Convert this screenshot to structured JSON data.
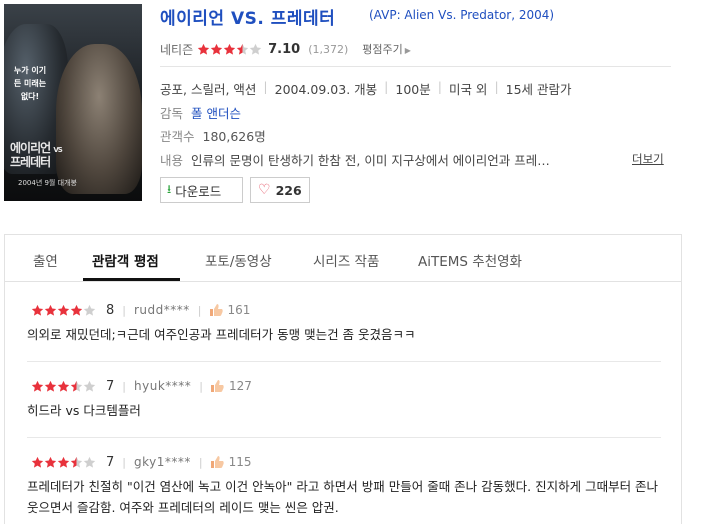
{
  "movie": {
    "title": "에이리언 VS. 프레데터",
    "subtitle": "(AVP: Alien Vs. Predator, 2004)",
    "rating_label": "네티즌",
    "rating_stars": 3.5,
    "rating_score": "7.10",
    "rating_votes": "(1,372)",
    "rate_button": "평점주기",
    "info": [
      "공포, 스릴러, 액션",
      "2004.09.03. 개봉",
      "100분",
      "미국 외",
      "15세 관람가"
    ],
    "director_label": "감독",
    "director": "폴 앤더슨",
    "viewers_label": "관객수",
    "viewers": "180,626명",
    "synopsis_label": "내용",
    "synopsis": "인류의 문명이 탄생하기 한참 전, 이미 지구상에서 에이리언과 프레…",
    "more_link": "더보기",
    "download_button": "다운로드",
    "like_count": "226"
  },
  "poster": {
    "tagline": "누가 이기든 미래는 없다!",
    "title_line1": "에이리언",
    "title_vs": "VS",
    "title_line2": "프레데터",
    "date": "2004년 9월 대개봉"
  },
  "tabs": [
    "출연",
    "관람객 평점",
    "포토/동영상",
    "시리즈 작품",
    "AiTEMS 추천영화"
  ],
  "active_tab": "관람객 평점",
  "reviews": [
    {
      "stars": 4,
      "score": "8",
      "user": "rudd****",
      "likes": "161",
      "text": "의외로 재밌던데;ㅋ근데 여주인공과 프레데터가 동맹 맺는건 좀 웃겼음ㅋㅋ"
    },
    {
      "stars": 3.5,
      "score": "7",
      "user": "hyuk****",
      "likes": "127",
      "text": "히드라 vs 다크템플러"
    },
    {
      "stars": 3.5,
      "score": "7",
      "user": "gky1****",
      "likes": "115",
      "text": "프레데터가 친절히 \"이건 염산에 녹고 이건 안녹아\" 라고 하면서 방패 만들어 줄때 존나 감동했다. 진지하게 그때부터 존나 웃으면서 즐감함. 여주와 프레데터의 레이드 맺는 씬은 압권."
    }
  ],
  "colors": {
    "star": "#e8323c",
    "star_empty": "#cfcfcf",
    "link": "#1f4fbf"
  }
}
